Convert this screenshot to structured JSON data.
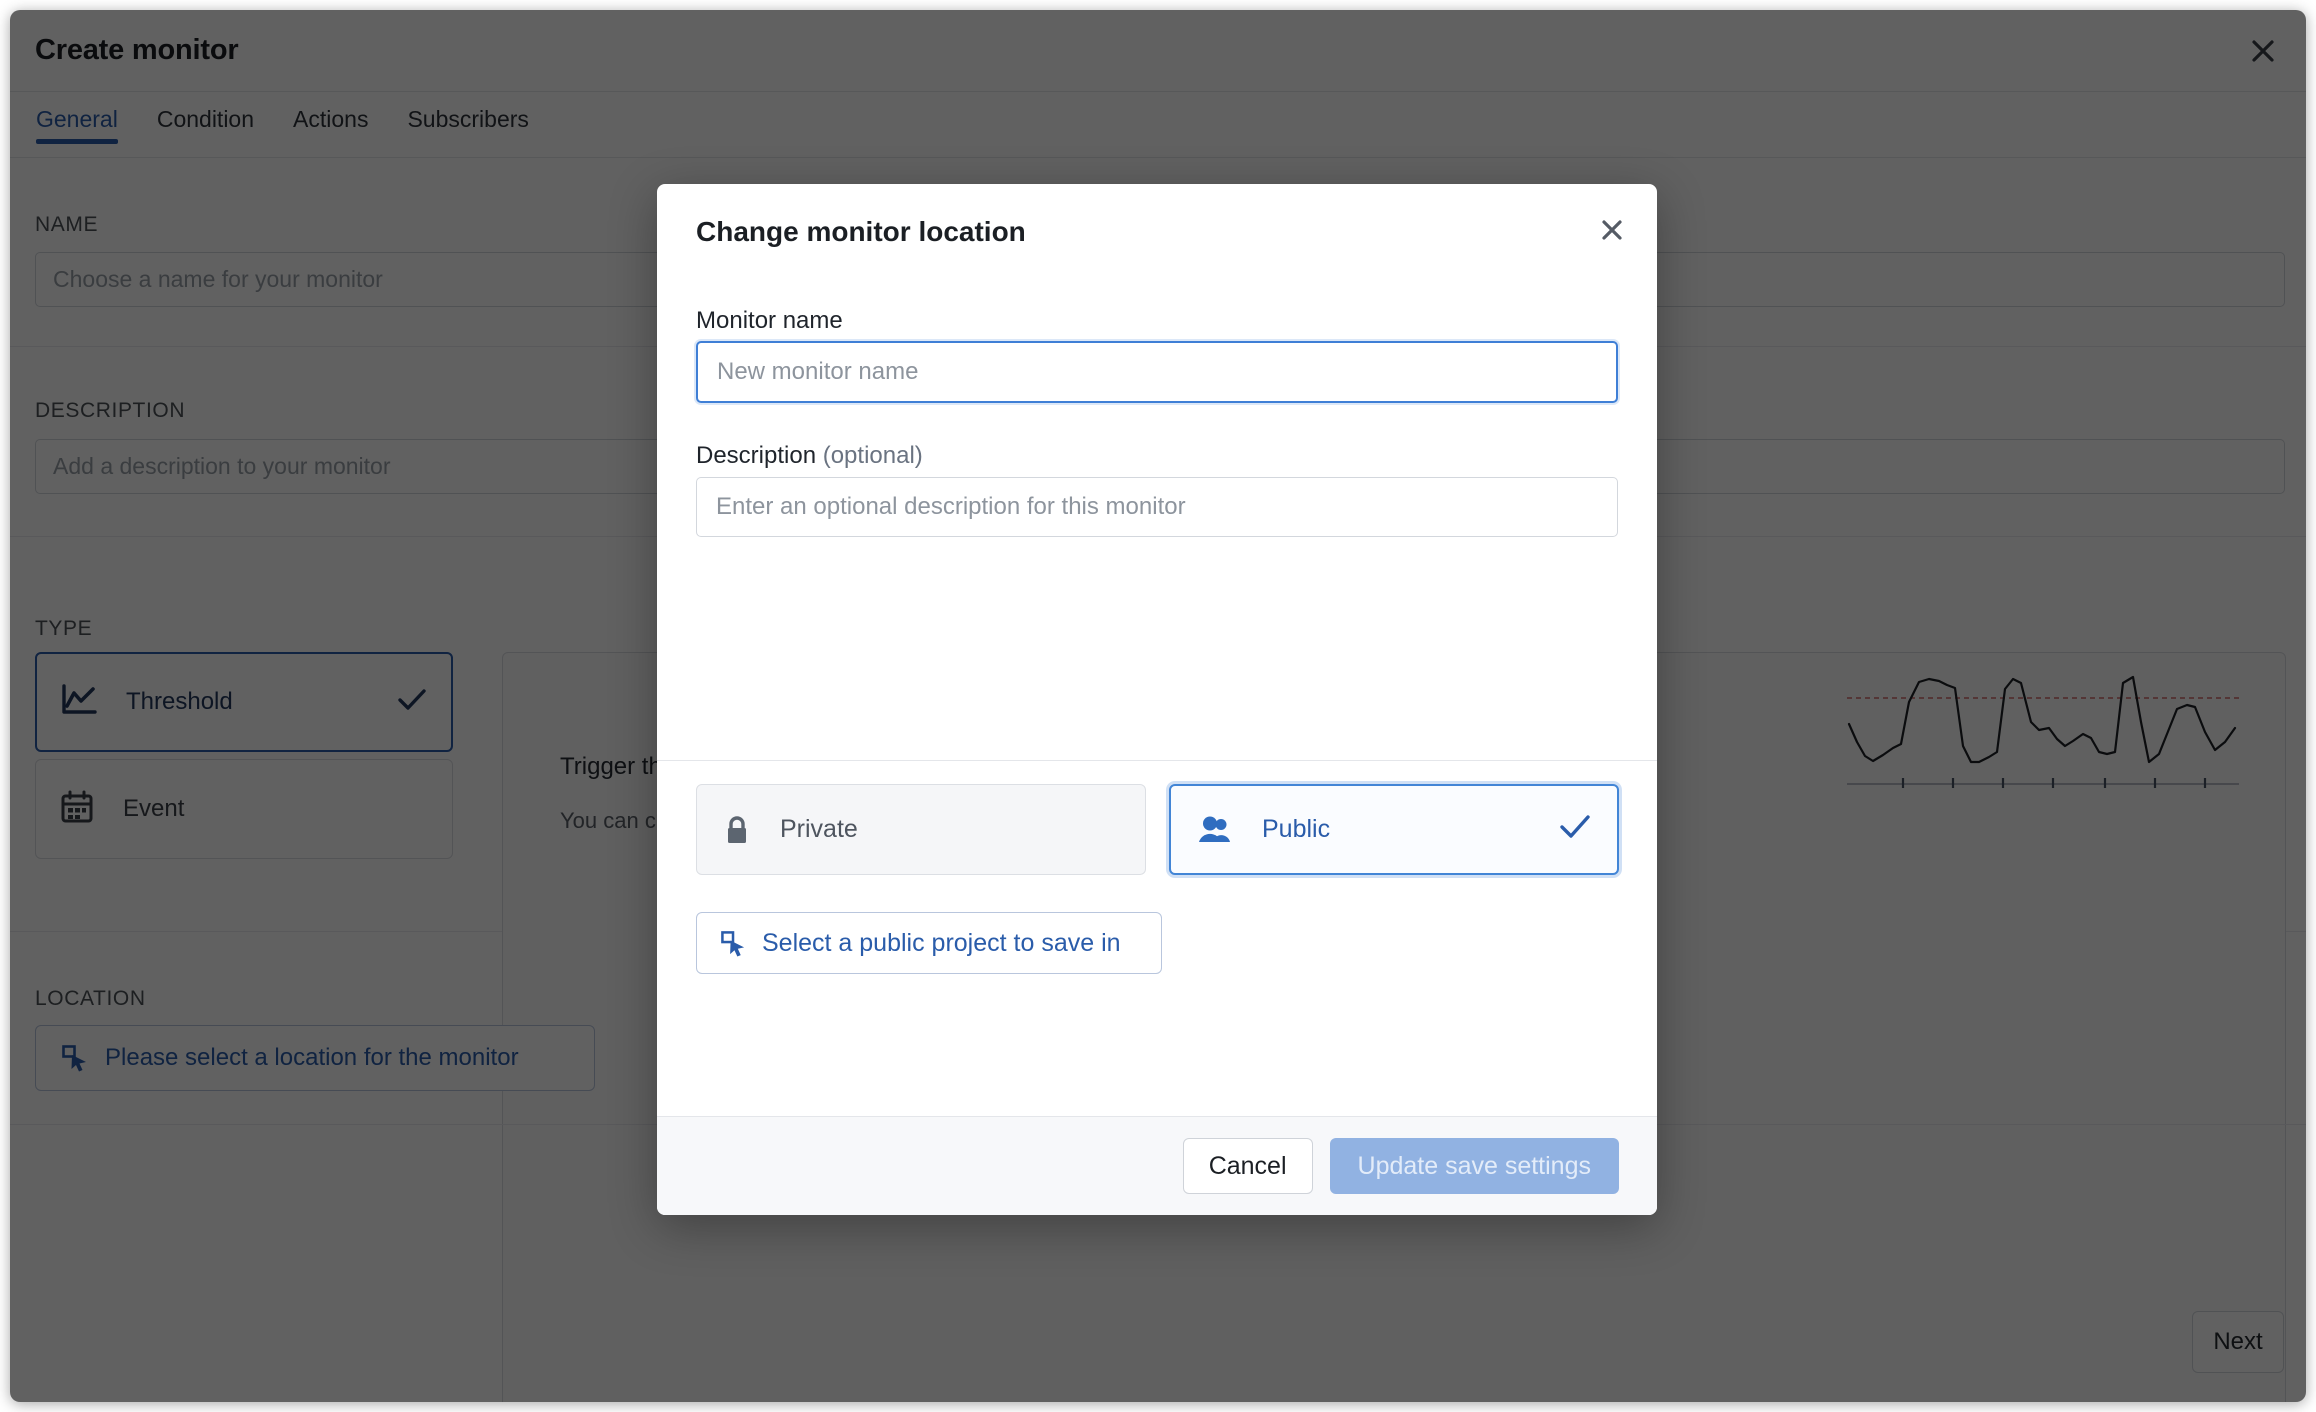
{
  "window": {
    "title": "Create monitor",
    "close_icon": "close-icon"
  },
  "tabs": [
    {
      "label": "General",
      "active": true
    },
    {
      "label": "Condition",
      "active": false
    },
    {
      "label": "Actions",
      "active": false
    },
    {
      "label": "Subscribers",
      "active": false
    }
  ],
  "form": {
    "name": {
      "label": "NAME",
      "placeholder": "Choose a name for your monitor",
      "value": ""
    },
    "description": {
      "label": "DESCRIPTION",
      "placeholder": "Add a description to your monitor",
      "value": ""
    },
    "type": {
      "label": "TYPE",
      "options": [
        {
          "label": "Threshold",
          "icon": "line-chart-icon",
          "selected": true
        },
        {
          "label": "Event",
          "icon": "calendar-icon",
          "selected": false
        }
      ],
      "panel": {
        "line1": "Trigger th",
        "line2": "You can c"
      }
    },
    "location": {
      "label": "LOCATION",
      "button_label": "Please select a location for the monitor",
      "button_icon": "select-cursor-icon"
    },
    "next_label": "Next"
  },
  "modal": {
    "title": "Change monitor location",
    "close_icon": "close-icon",
    "monitor_name": {
      "label": "Monitor name",
      "placeholder": "New monitor name",
      "value": "",
      "focused": true
    },
    "description": {
      "label": "Description",
      "label_optional": "(optional)",
      "placeholder": "Enter an optional description for this monitor",
      "value": ""
    },
    "visibility": [
      {
        "label": "Private",
        "icon": "lock-icon",
        "selected": false
      },
      {
        "label": "Public",
        "icon": "users-icon",
        "selected": true
      }
    ],
    "project_button": {
      "label": "Select a public project to save in",
      "icon": "select-cursor-icon"
    },
    "footer": {
      "cancel_label": "Cancel",
      "submit_label": "Update save settings",
      "submit_disabled": true
    }
  },
  "colors": {
    "accent": "#2a5caa",
    "accent_bright": "#4285d6",
    "primary_disabled": "#91b2e2",
    "threshold_line": "#d46a6a",
    "text": "#1b1f24"
  },
  "chart_data": {
    "type": "line",
    "title": "",
    "xlabel": "",
    "ylabel": "",
    "grid": false,
    "legend": null,
    "annotations": [
      {
        "type": "threshold-line",
        "style": "dashed",
        "color": "#d46a6a",
        "y": 78
      }
    ],
    "x": [
      0,
      1,
      2,
      3,
      4,
      5,
      6,
      7,
      8,
      9,
      10,
      11,
      12,
      13,
      14,
      15,
      16,
      17,
      18,
      19,
      20,
      21,
      22,
      23,
      24,
      25,
      26,
      27,
      28,
      29,
      30,
      31,
      32,
      33,
      34,
      35,
      36,
      37,
      38,
      39
    ],
    "y": [
      46,
      30,
      20,
      18,
      22,
      26,
      28,
      60,
      88,
      92,
      90,
      86,
      84,
      40,
      16,
      16,
      20,
      24,
      70,
      90,
      86,
      60,
      52,
      54,
      44,
      38,
      42,
      50,
      46,
      30,
      28,
      30,
      84,
      92,
      60,
      18,
      26,
      40,
      62,
      66
    ],
    "ylim": [
      0,
      100
    ],
    "xlim": [
      0,
      39
    ]
  }
}
